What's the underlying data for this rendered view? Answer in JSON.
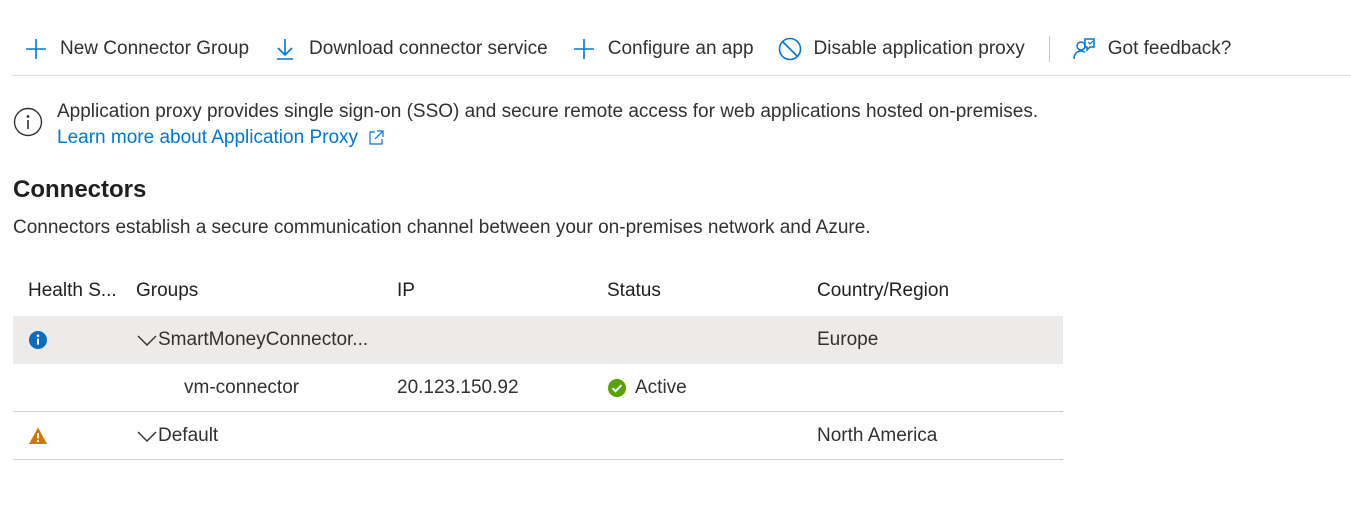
{
  "toolbar": {
    "new_group": "New Connector Group",
    "download": "Download connector service",
    "configure": "Configure an app",
    "disable": "Disable application proxy",
    "feedback": "Got feedback?"
  },
  "info": {
    "text": "Application proxy provides single sign-on (SSO) and secure remote access for web applications hosted on-premises.",
    "link": "Learn more about Application Proxy"
  },
  "section": {
    "title": "Connectors",
    "description": "Connectors establish a secure communication channel between your on-premises network and Azure."
  },
  "table": {
    "headers": {
      "health": "Health S...",
      "groups": "Groups",
      "ip": "IP",
      "status": "Status",
      "country": "Country/Region"
    },
    "rows": [
      {
        "health_icon": "info-icon",
        "group": "SmartMoneyConnector...",
        "ip": "",
        "status": "",
        "country": "Europe"
      },
      {
        "name": "vm-connector",
        "ip": "20.123.150.92",
        "status_icon": "check-circle-icon",
        "status": "Active",
        "country": ""
      },
      {
        "health_icon": "warning-icon",
        "group": "Default",
        "ip": "",
        "status": "",
        "country": "North America"
      }
    ]
  },
  "colors": {
    "accent": "#0078d4",
    "info_blue": "#0f6cbd",
    "warning": "#d47500",
    "success": "#57a300"
  }
}
